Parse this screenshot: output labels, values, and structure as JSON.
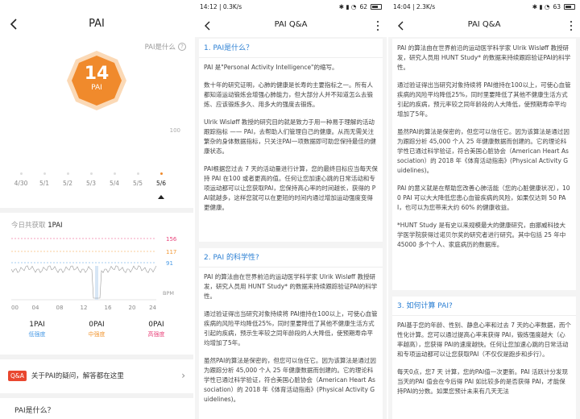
{
  "pai_screen": {
    "title": "PAI",
    "help_label": "PAI是什么",
    "badge_value": "14",
    "badge_unit": "PAI",
    "badge_color": "#f08a2c",
    "bar_scale": "100",
    "days": [
      "4/30",
      "5/1",
      "5/2",
      "5/3",
      "5/4",
      "5/5",
      "5/6"
    ],
    "selected_day": "5/6",
    "today_prefix": "今日共获取",
    "today_value": "1PAI",
    "hr_levels": [
      "156",
      "117",
      "91"
    ],
    "hr_level_colors": [
      "#e9477d",
      "#f29a38",
      "#4a9be6"
    ],
    "hr_unit": "BPM",
    "x_ticks": [
      "00",
      "04",
      "08",
      "12",
      "16",
      "20",
      "24"
    ],
    "summary": [
      {
        "value": "1PAI",
        "label": "低强度",
        "color": "#4a9be6"
      },
      {
        "value": "0PAI",
        "label": "中强度",
        "color": "#f29a38"
      },
      {
        "value": "0PAI",
        "label": "高强度",
        "color": "#e9477d"
      }
    ],
    "qa_badge": "Q&A",
    "qa_text": "关于PAI的疑问，解答都在这里",
    "bottom_label": "PAI是什么？"
  },
  "qa_screen_1": {
    "status_time": "14:12 | 0.3K/s",
    "battery": "62",
    "title": "PAI Q&A",
    "sections": [
      {
        "heading": "1. PAI是什么？",
        "paragraphs": [
          "PAI 是\"Personal Activity Intelligence\"的缩写。",
          "数十年的研究证明，心肺的健康是长寿的主要指标之一。所有人都知道运动锻炼会增强心肺能力，但大部分人并不知道怎么去锻炼、应该锻炼多久、用多大的强度去锻炼。",
          "Ulrik Wisløff 教授的研究目的就是致力于用一种易于理解的活动跟踪指标 —— PAI，去帮助人们管理自己的健康。从而无需关注繁杂的身体数据指标，只关注PAI一项数据即可助您保持最佳的健康状态。",
          "PAI根据您过去 7 天的活动量进行计算，您的最终目标应当每天保持 PAI 在100 或者更高的值。任何让您加速心跳的日常活动和专项运动都可以让您获取PAI，您保持高心率的时间越长，获得的 PAI就越多，这样您就可以在更短的时间内通过增加运动强度变得更健康。"
        ]
      },
      {
        "heading": "2. PAI 的科学性?",
        "paragraphs": [
          "PAI 的算法由在世界前沿的运动医学科学家 Ulrik Wisløff 教授研发，研究人员用 HUNT Study* 的数据来持续跟踪验证PAI的科学性。",
          "通过验证得出当研究对象持续将 PAI维持在100以上，可使心血管疾病的风险平均降低25%，同时里要降低了其他不健康生活方式引起的疾病，预示生率较之同年龄段的人大降低，使预期寿命平均增加了5年。",
          "虽然PAI的算法是保密的，但您可以信任它。因为该算法是通过因为跟踪分析 45,000 个人 25 年健康数据而创建的。它的理论科学性已通过科学验证，符合美国心脏协会（American Heart Association）的 2018 年《体育活动指南》(Physical Activity Guidelines)。"
        ]
      }
    ]
  },
  "qa_screen_2": {
    "status_time": "14:04 | 2.3K/s",
    "battery": "63",
    "title": "PAI Q&A",
    "top_paragraphs": [
      "PAI 的算法由在世界前沿的运动医学科学家 Ulrik Wisløff 教授研发，研究人员用 HUNT Study* 的数据来持续跟踪验证PAI的科学性。",
      "通过验证得出当研究对象持续将 PAI维持在100以上，可使心血管疾病的风险平均降低25%，同时里要降低了其他不健康生活方式引起的疾病，预元率较之同年龄段的人大降低，使预期寿命平均增加了5年。",
      "虽然PAI的算法是保密的，但您可以信任它。因为该算法是通过因为跟踪分析 45,000 个人 25 年健康数据而创建的。它的理论科学性已通过科学验证，符合美国心脏协会（American Heart Association）的 2018 年《体育活动指南》(Physical Activity Guidelines)。",
      "PAI 的意义就是在帮助您改善心肺活能（您的心脏健康状况），100 PAI 可以大大降低您患心血管疾病的风险，如果仅达到 50 PAI，也可以为您带来大约 60% 的健康收益。",
      "*HUNT Study 是有史以来规模最大的健康研究，由挪威科技大学医学院获得过诺贝尔奖的研究者进行研究。其中包括 25 年中 45000 多个个人、家庭病历的数据库。"
    ],
    "section3_heading": "3. 如何计算 PAI?",
    "section3_paragraphs": [
      "PAI基于您的年龄、性别、静息心率和过去 7 天的心率数据，而个性化计算。您可以通过提高心率来获得 PAI，锻炼强度越大（心率越高），您获得 PAI的速度越快。任何让您加速心跳的日常活动和专项运动都可以让您获取PAI（不仅仅是跑步和步行）。",
      "每天0点，您7 天 计算，您的PAI值一次更新。PAI 活跃计分发现当天的PAI 值会在今后得 PAI 如比较多的是否获得 PAI，才能保持PAI的分数。如果您预计未来有几天无法"
    ]
  }
}
